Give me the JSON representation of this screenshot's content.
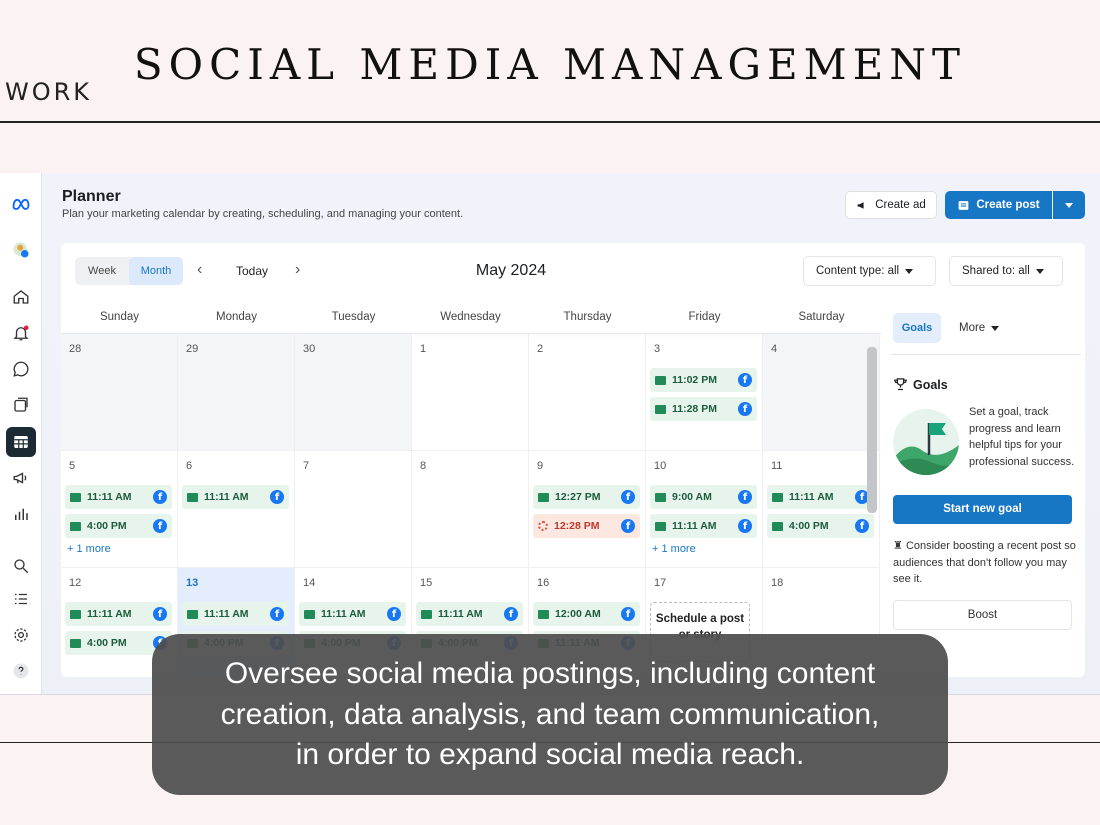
{
  "slide": {
    "title": "SOCIAL MEDIA MANAGEMENT",
    "tag": "WORK"
  },
  "planner": {
    "title": "Planner",
    "subtitle": "Plan your marketing calendar by creating, scheduling, and managing your content.",
    "create_ad": "Create ad",
    "create_post": "Create post",
    "view_week": "Week",
    "view_month": "Month",
    "today": "Today",
    "month": "May 2024",
    "content_type": "Content type: all",
    "shared_to": "Shared to: all",
    "weekdays": [
      "Sunday",
      "Monday",
      "Tuesday",
      "Wednesday",
      "Thursday",
      "Friday",
      "Saturday"
    ],
    "weeks": [
      [
        {
          "day": "28",
          "other": true,
          "posts": []
        },
        {
          "day": "29",
          "other": true,
          "posts": []
        },
        {
          "day": "30",
          "other": true,
          "posts": []
        },
        {
          "day": "1",
          "posts": []
        },
        {
          "day": "2",
          "posts": []
        },
        {
          "day": "3",
          "posts": [
            {
              "time": "11:02 PM"
            },
            {
              "time": "11:28 PM"
            }
          ]
        },
        {
          "day": "4",
          "other": true,
          "posts": []
        }
      ],
      [
        {
          "day": "5",
          "posts": [
            {
              "time": "11:11 AM"
            },
            {
              "time": "4:00 PM"
            }
          ],
          "more": "+ 1 more"
        },
        {
          "day": "6",
          "posts": [
            {
              "time": "11:11 AM"
            }
          ]
        },
        {
          "day": "7",
          "posts": []
        },
        {
          "day": "8",
          "posts": []
        },
        {
          "day": "9",
          "posts": [
            {
              "time": "12:27 PM"
            },
            {
              "time": "12:28 PM",
              "error": true
            }
          ]
        },
        {
          "day": "10",
          "posts": [
            {
              "time": "9:00 AM"
            },
            {
              "time": "11:11 AM"
            }
          ],
          "more": "+ 1 more"
        },
        {
          "day": "11",
          "posts": [
            {
              "time": "11:11 AM"
            },
            {
              "time": "4:00 PM"
            }
          ]
        }
      ],
      [
        {
          "day": "12",
          "posts": [
            {
              "time": "11:11 AM"
            },
            {
              "time": "4:00 PM"
            }
          ]
        },
        {
          "day": "13",
          "today": true,
          "posts": [
            {
              "time": "11:11 AM"
            },
            {
              "time": "4:00 PM"
            }
          ]
        },
        {
          "day": "14",
          "posts": [
            {
              "time": "11:11 AM"
            },
            {
              "time": "4:00 PM"
            }
          ]
        },
        {
          "day": "15",
          "posts": [
            {
              "time": "11:11 AM"
            },
            {
              "time": "4:00 PM"
            }
          ]
        },
        {
          "day": "16",
          "posts": [
            {
              "time": "12:00 AM"
            },
            {
              "time": "11:11 AM"
            }
          ]
        },
        {
          "day": "17",
          "schedule": "Schedule a post or story",
          "posts": []
        },
        {
          "day": "18",
          "posts": []
        }
      ]
    ]
  },
  "goals_panel": {
    "tab_goals": "Goals",
    "tab_more": "More",
    "heading": "Goals",
    "description": "Set a goal, track progress and learn helpful tips for your professional success.",
    "start_goal": "Start new goal",
    "boost_tip": "Consider boosting a recent post so audiences that don't follow you may see it.",
    "boost": "Boost"
  },
  "caption": {
    "lines": [
      "Oversee social media postings, including content",
      "creation, data analysis, and team communication,",
      "in order to expand social media reach."
    ]
  },
  "colors": {
    "accent": "#1877c4",
    "facebook": "#1877f2",
    "post_bg": "#e6f4ec",
    "error_bg": "#fde7e1"
  }
}
